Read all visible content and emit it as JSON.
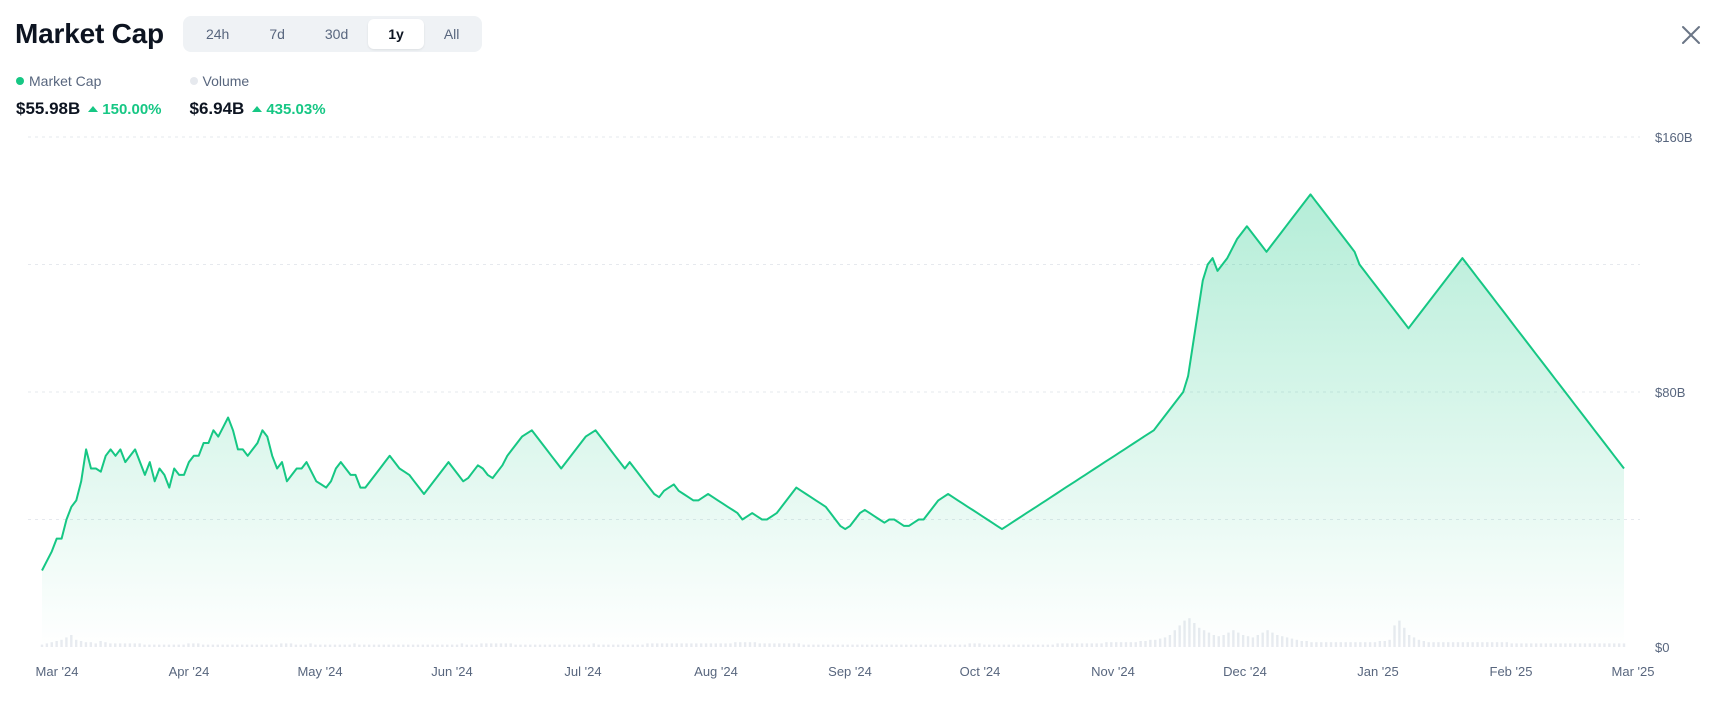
{
  "header": {
    "title": "Market Cap",
    "ranges": [
      "24h",
      "7d",
      "30d",
      "1y",
      "All"
    ],
    "active_range": "1y"
  },
  "icons": {
    "close": "close-icon"
  },
  "legend": [
    {
      "name": "Market Cap",
      "value": "$55.98B",
      "change": "150.00%",
      "color": "#16c784"
    },
    {
      "name": "Volume",
      "value": "$6.94B",
      "change": "435.03%",
      "color": "#eceff3"
    }
  ],
  "colors": {
    "accent": "#16c784",
    "grid": "#e6e9ee",
    "volume": "#e8ebf0",
    "text_secondary": "#58667e"
  },
  "chart_data": {
    "type": "area",
    "x_ticks": [
      "Mar '24",
      "Apr '24",
      "May '24",
      "Jun '24",
      "Jul '24",
      "Aug '24",
      "Sep '24",
      "Oct '24",
      "Nov '24",
      "Dec '24",
      "Jan '25",
      "Feb '25",
      "Mar '25"
    ],
    "y_ticks": [
      "$160B",
      "$80B",
      "$0"
    ],
    "ylim": [
      0,
      160
    ],
    "grid": true,
    "series": [
      {
        "name": "Market Cap",
        "unit": "B USD",
        "x": [
          "Mar '24",
          "Mar '24",
          "Mar '24",
          "Mar '24",
          "Mar '24",
          "Apr '24",
          "Apr '24",
          "Apr '24",
          "Apr '24",
          "Apr '24",
          "May '24",
          "May '24",
          "May '24",
          "May '24",
          "Jun '24",
          "Jun '24",
          "Jun '24",
          "Jun '24",
          "Jul '24",
          "Jul '24",
          "Jul '24",
          "Jul '24",
          "Aug '24",
          "Aug '24",
          "Aug '24",
          "Aug '24",
          "Sep '24",
          "Sep '24",
          "Sep '24",
          "Sep '24",
          "Oct '24",
          "Oct '24",
          "Oct '24",
          "Oct '24",
          "Nov '24",
          "Nov '24",
          "Nov '24",
          "Nov '24",
          "Dec '24",
          "Dec '24",
          "Dec '24",
          "Dec '24",
          "Jan '25",
          "Jan '25",
          "Jan '25",
          "Jan '25",
          "Feb '25",
          "Feb '25",
          "Feb '25",
          "Feb '25",
          "Mar '25"
        ],
        "values": [
          24,
          34,
          62,
          66,
          58,
          70,
          70,
          62,
          55,
          53,
          58,
          52,
          51,
          60,
          67,
          64,
          58,
          52,
          48,
          46,
          40,
          42,
          50,
          48,
          36,
          38,
          36,
          36,
          38,
          35,
          40,
          48,
          46,
          54,
          60,
          62,
          68,
          120,
          124,
          136,
          142,
          120,
          104,
          116,
          120,
          100,
          102,
          90,
          70,
          66,
          56
        ],
        "daily": [
          24,
          27,
          30,
          34,
          34,
          40,
          44,
          46,
          52,
          62,
          56,
          56,
          55,
          60,
          62,
          60,
          62,
          58,
          60,
          62,
          58,
          54,
          58,
          52,
          56,
          54,
          50,
          56,
          54,
          54,
          58,
          60,
          60,
          64,
          64,
          68,
          66,
          69,
          72,
          68,
          62,
          62,
          60,
          62,
          64,
          68,
          66,
          60,
          56,
          58,
          52,
          54,
          56,
          56,
          58,
          55,
          52,
          51,
          50,
          52,
          56,
          58,
          56,
          54,
          54,
          50,
          50,
          52,
          54,
          56,
          58,
          60,
          58,
          56,
          55,
          54,
          52,
          50,
          48,
          50,
          52,
          54,
          56,
          58,
          56,
          54,
          52,
          53,
          55,
          57,
          56,
          54,
          53,
          55,
          57,
          60,
          62,
          64,
          66,
          67,
          68,
          66,
          64,
          62,
          60,
          58,
          56,
          58,
          60,
          62,
          64,
          66,
          67,
          68,
          66,
          64,
          62,
          60,
          58,
          56,
          58,
          56,
          54,
          52,
          50,
          48,
          47,
          49,
          50,
          51,
          49,
          48,
          47,
          46,
          46,
          47,
          48,
          47,
          46,
          45,
          44,
          43,
          42,
          40,
          41,
          42,
          41,
          40,
          40,
          41,
          42,
          44,
          46,
          48,
          50,
          49,
          48,
          47,
          46,
          45,
          44,
          42,
          40,
          38,
          37,
          38,
          40,
          42,
          43,
          42,
          41,
          40,
          39,
          40,
          40,
          39,
          38,
          38,
          39,
          40,
          40,
          42,
          44,
          46,
          47,
          48,
          47,
          46,
          45,
          44,
          43,
          42,
          41,
          40,
          39,
          38,
          37,
          38,
          39,
          40,
          41,
          42,
          43,
          44,
          45,
          46,
          47,
          48,
          49,
          50,
          51,
          52,
          53,
          54,
          55,
          56,
          57,
          58,
          59,
          60,
          61,
          62,
          63,
          64,
          65,
          66,
          67,
          68,
          70,
          72,
          74,
          76,
          78,
          80,
          85,
          95,
          105,
          115,
          120,
          122,
          118,
          120,
          122,
          125,
          128,
          130,
          132,
          130,
          128,
          126,
          124,
          126,
          128,
          130,
          132,
          134,
          136,
          138,
          140,
          142,
          140,
          138,
          136,
          134,
          132,
          130,
          128,
          126,
          124,
          120,
          118,
          116,
          114,
          112,
          110,
          108,
          106,
          104,
          102,
          100,
          102,
          104,
          106,
          108,
          110,
          112,
          114,
          116,
          118,
          120,
          122,
          120,
          118,
          116,
          114,
          112,
          110,
          108,
          106,
          104,
          102,
          100,
          98,
          96,
          94,
          92,
          90,
          88,
          86,
          84,
          82,
          80,
          78,
          76,
          74,
          72,
          70,
          68,
          66,
          64,
          62,
          60,
          58,
          56
        ]
      },
      {
        "name": "Volume",
        "unit": "B USD",
        "daily_pct": [
          2,
          3,
          4,
          5,
          6,
          8,
          10,
          6,
          5,
          4,
          4,
          3,
          5,
          4,
          3,
          3,
          3,
          3,
          3,
          3,
          3,
          2,
          2,
          2,
          2,
          2,
          2,
          2,
          2,
          2,
          3,
          3,
          3,
          2,
          2,
          2,
          2,
          2,
          2,
          2,
          2,
          2,
          2,
          2,
          2,
          2,
          2,
          2,
          2,
          3,
          3,
          3,
          2,
          2,
          2,
          3,
          2,
          2,
          2,
          2,
          2,
          2,
          2,
          2,
          3,
          2,
          2,
          2,
          2,
          2,
          2,
          2,
          2,
          2,
          2,
          2,
          2,
          2,
          2,
          2,
          2,
          2,
          2,
          2,
          2,
          2,
          3,
          2,
          2,
          2,
          3,
          3,
          3,
          3,
          3,
          3,
          3,
          2,
          2,
          2,
          2,
          2,
          2,
          2,
          2,
          2,
          2,
          2,
          2,
          2,
          2,
          2,
          2,
          3,
          2,
          2,
          2,
          2,
          2,
          2,
          2,
          2,
          2,
          2,
          3,
          3,
          3,
          3,
          3,
          3,
          3,
          3,
          3,
          3,
          3,
          3,
          3,
          3,
          3,
          3,
          3,
          3,
          4,
          4,
          4,
          4,
          4,
          3,
          3,
          3,
          3,
          3,
          3,
          3,
          3,
          3,
          2,
          2,
          2,
          2,
          2,
          2,
          2,
          2,
          2,
          2,
          2,
          2,
          2,
          2,
          2,
          2,
          2,
          2,
          2,
          2,
          2,
          2,
          2,
          2,
          2,
          2,
          2,
          2,
          2,
          2,
          2,
          2,
          2,
          2,
          3,
          3,
          3,
          2,
          2,
          2,
          2,
          2,
          2,
          2,
          2,
          2,
          2,
          2,
          2,
          2,
          2,
          2,
          3,
          3,
          3,
          3,
          3,
          3,
          3,
          3,
          3,
          3,
          4,
          4,
          4,
          4,
          4,
          4,
          4,
          5,
          5,
          6,
          6,
          7,
          8,
          10,
          14,
          18,
          22,
          24,
          20,
          16,
          14,
          12,
          10,
          9,
          10,
          12,
          14,
          12,
          10,
          9,
          8,
          10,
          12,
          14,
          12,
          10,
          9,
          8,
          7,
          6,
          5,
          5,
          4,
          4,
          4,
          4,
          4,
          4,
          4,
          4,
          4,
          4,
          4,
          4,
          4,
          4,
          5,
          5,
          6,
          18,
          22,
          16,
          10,
          8,
          6,
          5,
          4,
          4,
          4,
          4,
          4,
          4,
          4,
          4,
          4,
          4,
          4,
          4,
          4,
          4,
          4,
          4,
          4,
          3,
          3,
          3,
          3,
          3,
          3,
          3,
          3,
          3,
          3,
          3,
          3,
          3,
          3,
          3,
          3,
          3,
          3,
          3,
          3,
          3,
          3,
          3,
          3
        ]
      }
    ]
  }
}
